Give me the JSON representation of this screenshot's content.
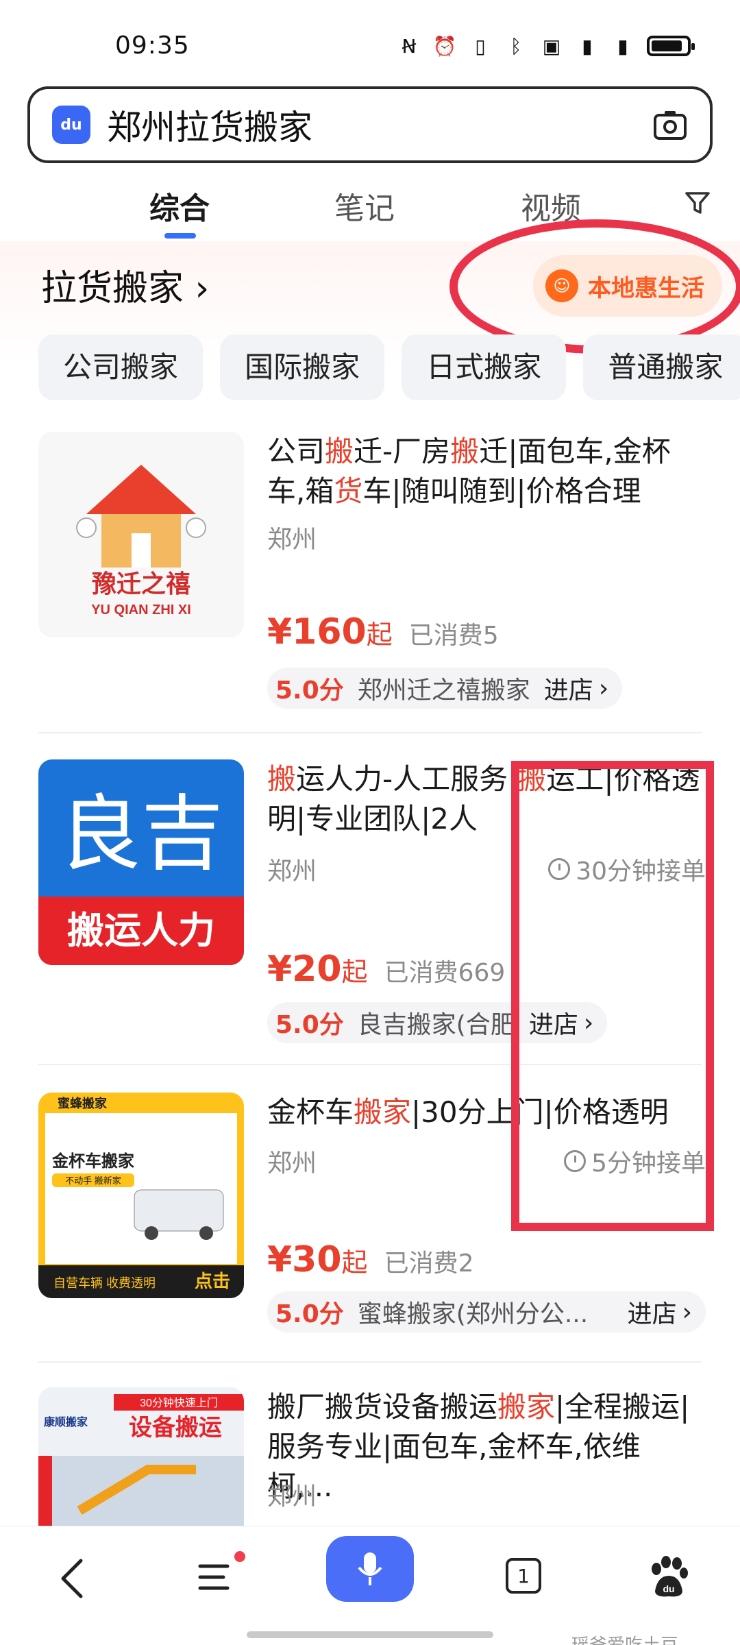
{
  "status_bar": {
    "time": "09:35"
  },
  "search": {
    "query": "郑州拉货搬家"
  },
  "tabs": [
    {
      "label": "综合"
    },
    {
      "label": "笔记"
    },
    {
      "label": "视频"
    }
  ],
  "section": {
    "title": "拉货搬家",
    "local_pill": "本地惠生活",
    "chips": [
      "公司搬家",
      "国际搬家",
      "日式搬家",
      "普通搬家"
    ]
  },
  "listings": [
    {
      "title_parts": [
        "公司",
        "搬",
        "迁-厂房",
        "搬",
        "迁|面包车,金杯车,箱",
        "货",
        "车|随叫随到|价格合理"
      ],
      "city": "郑州",
      "response_time": "",
      "price": "¥160",
      "price_suffix": "起",
      "sold": "已消费5",
      "score": "5.0分",
      "shop_name": "郑州迁之禧搬家",
      "enter": "进店",
      "thumb_text_1": "豫迁之禧",
      "thumb_text_2": "YU QIAN ZHI XI"
    },
    {
      "title_parts": [
        "搬",
        "运人力-人工服务|",
        "搬",
        "运工|价格透明|专业团队|2人"
      ],
      "city": "郑州",
      "response_time": "30分钟接单",
      "price": "¥20",
      "price_suffix": "起",
      "sold": "已消费669",
      "score": "5.0分",
      "shop_name": "良吉搬家(合肥",
      "enter": "进店",
      "thumb_text_1": "良吉",
      "thumb_text_2": "搬运人力"
    },
    {
      "title_parts": [
        "金杯车",
        "搬家",
        "|30分上门|价格透明"
      ],
      "city": "郑州",
      "response_time": "5分钟接单",
      "price": "¥30",
      "price_suffix": "起",
      "sold": "已消费2",
      "score": "5.0分",
      "shop_name": "蜜蜂搬家(郑州分公...",
      "enter": "进店",
      "thumb_text_1": "蜜蜂搬家",
      "thumb_text_2": "金杯车搬家",
      "thumb_text_3": "不动手 搬新家",
      "thumb_text_4": "自营车辆 收费透明",
      "thumb_text_5": "点击"
    },
    {
      "title_parts": [
        "搬厂搬货设备搬运",
        "搬家",
        "|全程搬运|服务专业|面包车,金杯车,依维柯,..."
      ],
      "city": "郑州",
      "thumb_text_1": "30分钟快速上门",
      "thumb_text_2": "设备搬运",
      "thumb_text_3": "康顺搬家"
    }
  ],
  "bottom_nav": {
    "tab_count": "1"
  },
  "watermark": "瑶爸爱吃土豆",
  "colors": {
    "accent": "#3370ff",
    "price": "#e8402c",
    "annotation": "#e8334a",
    "local": "#ff5a1f"
  }
}
